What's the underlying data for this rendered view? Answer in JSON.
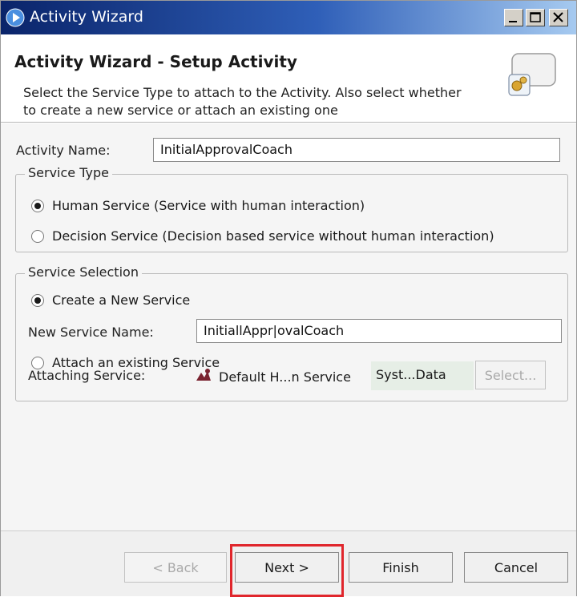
{
  "window": {
    "title": "Activity Wizard"
  },
  "header": {
    "title": "Activity Wizard - Setup Activity",
    "description": "Select the Service Type to attach to the Activity. Also select whether to create a new service or attach an existing one"
  },
  "form": {
    "activity_name_label": "Activity Name:",
    "activity_name_value": "InitialApprovalCoach"
  },
  "service_type": {
    "legend": "Service Type",
    "options": [
      {
        "label": "Human Service (Service with human interaction)",
        "selected": true
      },
      {
        "label": "Decision Service (Decision based service without human interaction)",
        "selected": false
      }
    ]
  },
  "service_selection": {
    "legend": "Service Selection",
    "create_new_label": "Create a New Service",
    "new_service_name_label": "New Service Name:",
    "new_service_name_value": "InitiallAppr|ovalCoach",
    "attach_existing_label": "Attach an existing Service",
    "attaching_service_label": "Attaching Service:",
    "attaching_service_value": "Default H...n Service",
    "attaching_service_icon": "service-icon",
    "toolkit_value": "Syst...Data",
    "select_button": "Select..."
  },
  "footer": {
    "back_label": "< Back",
    "next_label": "Next >",
    "finish_label": "Finish",
    "cancel_label": "Cancel"
  },
  "colors": {
    "titlebar_start": "#0a246a",
    "titlebar_end": "#a6caf0",
    "highlight": "#e0262c",
    "service_icon": "#7a2330"
  }
}
